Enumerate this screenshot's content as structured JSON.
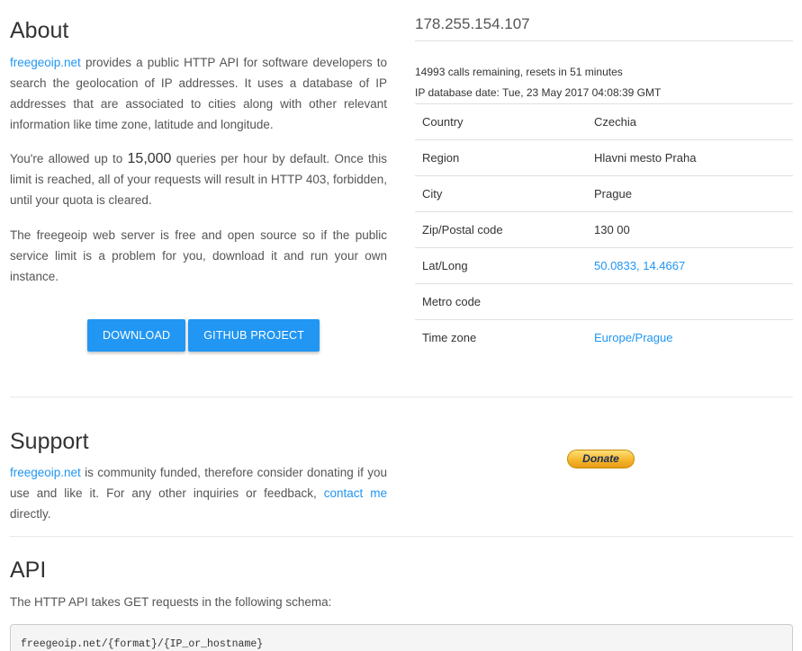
{
  "about": {
    "title": "About",
    "p1_link": "freegeoip.net",
    "p1_text": " provides a public HTTP API for software developers to search the geolocation of IP addresses. It uses a database of IP addresses that are associated to cities along with other relevant information like time zone, latitude and longitude.",
    "p2_pre": "You're allowed up to ",
    "p2_big": "15,000",
    "p2_post": " queries per hour by default. Once this limit is reached, all of your requests will result in HTTP 403, forbidden, until your quota is cleared.",
    "p3_text": "The freegeoip web server is free and open source so if the public service limit is a problem for you, download it and run your own instance.",
    "download_label": "DOWNLOAD",
    "github_label": "GITHUB PROJECT"
  },
  "lookup": {
    "ip": "178.255.154.107",
    "calls": "14993 calls remaining, resets in 51 minutes",
    "db_date": "IP database date: Tue, 23 May 2017 04:08:39 GMT",
    "rows": [
      {
        "key": "Country",
        "value": "Czechia"
      },
      {
        "key": "Region",
        "value": "Hlavni mesto Praha"
      },
      {
        "key": "City",
        "value": "Prague"
      },
      {
        "key": "Zip/Postal code",
        "value": "130 00"
      },
      {
        "key": "Lat/Long",
        "value": "50.0833, 14.4667"
      },
      {
        "key": "Metro code",
        "value": ""
      },
      {
        "key": "Time zone",
        "value": "Europe/Prague"
      }
    ]
  },
  "support": {
    "title": "Support",
    "link1": "freegeoip.net",
    "text1": " is community funded, therefore consider donating if you use and like it. For any other inquiries or feedback, ",
    "link2": "contact me",
    "text2": " directly.",
    "donate_label": "Donate"
  },
  "api": {
    "title": "API",
    "intro": "The HTTP API takes GET requests in the following schema:",
    "schema": "freegeoip.net/{format}/{IP_or_hostname}"
  },
  "colors": {
    "link": "#2196f3",
    "button": "#2196f3",
    "donate": "#f6b72d"
  }
}
